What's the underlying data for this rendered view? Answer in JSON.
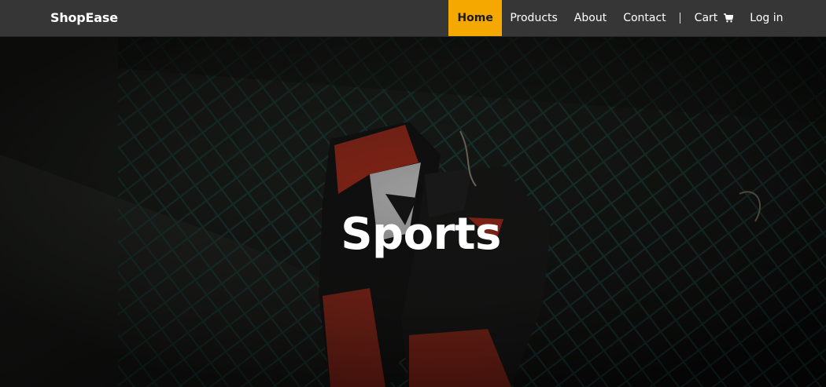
{
  "brand": {
    "name": "ShopEase"
  },
  "nav": {
    "items": [
      {
        "label": "Home",
        "active": true
      },
      {
        "label": "Products",
        "active": false
      },
      {
        "label": "About",
        "active": false
      },
      {
        "label": "Contact",
        "active": false
      }
    ],
    "cart_label": "Cart",
    "cart_icon": "cart-icon",
    "login_label": "Log in"
  },
  "hero": {
    "title": "Sports",
    "image": "sneakers-hanging-on-chain-link-fence"
  },
  "colors": {
    "navbar_bg": "#363636",
    "active_accent": "#f5a800",
    "text": "#ffffff"
  }
}
